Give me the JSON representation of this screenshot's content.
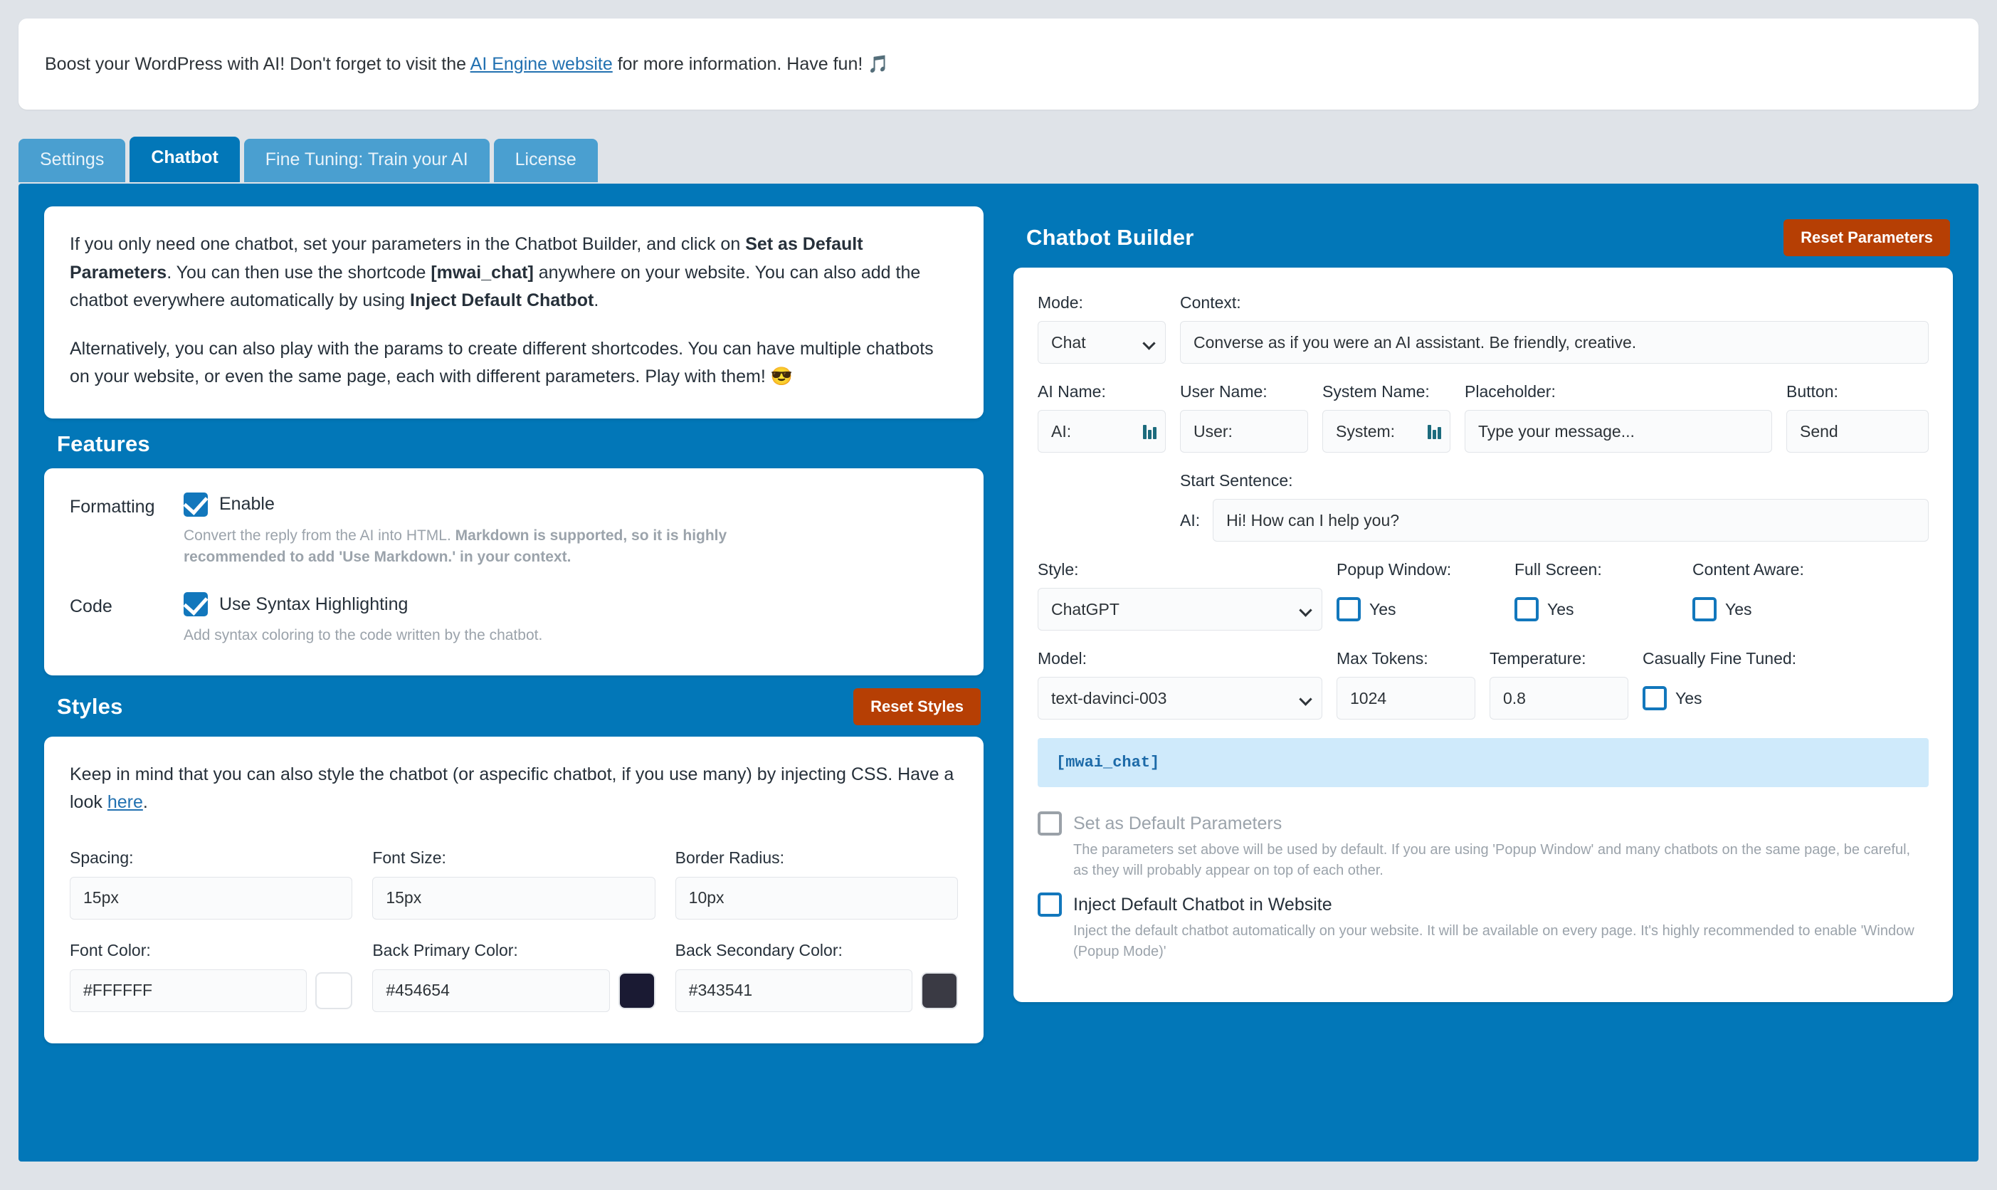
{
  "notice": {
    "pre": "Boost your WordPress with AI! Don't forget to visit the ",
    "link": "AI Engine website",
    "post": " for more information. Have fun! ",
    "emoji": "🎵"
  },
  "tabs": [
    {
      "label": "Settings",
      "active": false
    },
    {
      "label": "Chatbot",
      "active": true
    },
    {
      "label": "Fine Tuning: Train your AI",
      "active": false
    },
    {
      "label": "License",
      "active": false
    }
  ],
  "intro": {
    "p1_a": "If you only need one chatbot, set your parameters in the Chatbot Builder, and click on ",
    "p1_b": "Set as Default Parameters",
    "p1_c": ". You can then use the shortcode ",
    "p1_d": "[mwai_chat]",
    "p1_e": " anywhere on your website. You can also add the chatbot everywhere automatically by using ",
    "p1_f": "Inject Default Chatbot",
    "p1_g": ".",
    "p2": "Alternatively, you can also play with the params to create different shortcodes. You can have multiple chatbots on your website, or even the same page, each with different parameters. Play with them! 😎"
  },
  "features": {
    "title": "Features",
    "rows": [
      {
        "label": "Formatting",
        "checkbox_label": "Enable",
        "checked": true,
        "desc_plain": "Convert the reply from the AI into HTML. ",
        "desc_bold": "Markdown is supported, so it is highly recommended to add 'Use Markdown.' in your context."
      },
      {
        "label": "Code",
        "checkbox_label": "Use Syntax Highlighting",
        "checked": true,
        "desc_plain": "Add syntax coloring to the code written by the chatbot.",
        "desc_bold": ""
      }
    ]
  },
  "styles": {
    "title": "Styles",
    "reset_label": "Reset Styles",
    "note_a": "Keep in mind that you can also style the chatbot (or aspecific chatbot, if you use many) by injecting CSS. Have a look ",
    "note_link": "here",
    "note_b": ".",
    "fields": {
      "spacing_label": "Spacing:",
      "spacing_value": "15px",
      "font_size_label": "Font Size:",
      "font_size_value": "15px",
      "border_radius_label": "Border Radius:",
      "border_radius_value": "10px",
      "font_color_label": "Font Color:",
      "font_color_value": "#FFFFFF",
      "font_color_swatch": "#FFFFFF",
      "back_primary_label": "Back Primary Color:",
      "back_primary_value": "#454654",
      "back_primary_swatch": "#1a1a33",
      "back_secondary_label": "Back Secondary Color:",
      "back_secondary_value": "#343541",
      "back_secondary_swatch": "#3a3a44"
    }
  },
  "builder": {
    "title": "Chatbot Builder",
    "reset_label": "Reset Parameters",
    "mode_label": "Mode:",
    "mode_value": "Chat",
    "context_label": "Context:",
    "context_value": "Converse as if you were an AI assistant. Be friendly, creative.",
    "ai_name_label": "AI Name:",
    "ai_name_value": "AI:",
    "user_name_label": "User Name:",
    "user_name_value": "User:",
    "system_name_label": "System Name:",
    "system_name_value": "System:",
    "placeholder_label": "Placeholder:",
    "placeholder_value": "Type your message...",
    "button_label": "Button:",
    "button_value": "Send",
    "start_sentence_label": "Start Sentence:",
    "start_sentence_prefix": "AI:",
    "start_sentence_value": "Hi! How can I help you?",
    "style_label": "Style:",
    "style_value": "ChatGPT",
    "popup_window_label": "Popup Window:",
    "popup_window_yes": "Yes",
    "popup_window_checked": false,
    "full_screen_label": "Full Screen:",
    "full_screen_yes": "Yes",
    "full_screen_checked": false,
    "content_aware_label": "Content Aware:",
    "content_aware_yes": "Yes",
    "content_aware_checked": false,
    "model_label": "Model:",
    "model_value": "text-davinci-003",
    "max_tokens_label": "Max Tokens:",
    "max_tokens_value": "1024",
    "temperature_label": "Temperature:",
    "temperature_value": "0.8",
    "fine_tuned_label": "Casually Fine Tuned:",
    "fine_tuned_yes": "Yes",
    "fine_tuned_checked": false,
    "shortcode": "[mwai_chat]",
    "default_params_label": "Set as Default Parameters",
    "default_params_desc": "The parameters set above will be used by default. If you are using 'Popup Window' and many chatbots on the same page, be careful, as they will probably appear on top of each other.",
    "default_params_checked": false,
    "inject_label": "Inject Default Chatbot in Website",
    "inject_desc": "Inject the default chatbot automatically on your website. It will be available on every page. It's highly recommended to enable 'Window (Popup Mode)'",
    "inject_checked": false
  },
  "colors": {
    "brand_blue": "#0277b8",
    "tab_inactive": "#4a9fd0",
    "orange": "#b63f04",
    "page_bg": "#dfe3e8",
    "shortcode_bg": "#cfeafb"
  }
}
